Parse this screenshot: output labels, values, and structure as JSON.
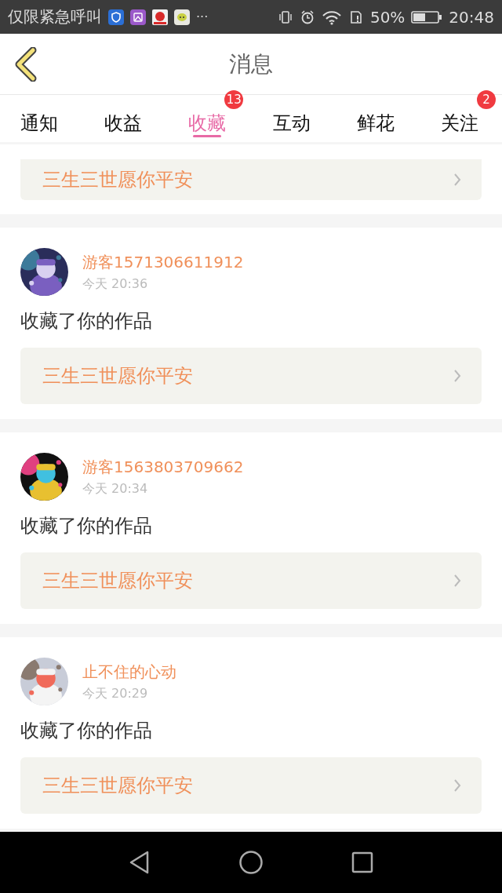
{
  "status_bar": {
    "notice": "仅限紧急呼叫",
    "more": "···",
    "battery": "50%",
    "time": "20:48"
  },
  "header": {
    "title": "消息"
  },
  "tabs": [
    {
      "label": "通知",
      "selected": false
    },
    {
      "label": "收益",
      "selected": false
    },
    {
      "label": "收藏",
      "selected": true,
      "badge": "13"
    },
    {
      "label": "互动",
      "selected": false
    },
    {
      "label": "鲜花",
      "selected": false
    },
    {
      "label": "关注",
      "selected": false,
      "badge": "2"
    }
  ],
  "partial_item": {
    "work_title": "三生三世愿你平安"
  },
  "items": [
    {
      "username": "游客1571306611912",
      "time": "今天 20:36",
      "action": "收藏了你的作品",
      "work_title": "三生三世愿你平安"
    },
    {
      "username": "游客1563803709662",
      "time": "今天 20:34",
      "action": "收藏了你的作品",
      "work_title": "三生三世愿你平安"
    },
    {
      "username": "止不住的心动",
      "time": "今天 20:29",
      "action": "收藏了你的作品",
      "work_title": "三生三世愿你平安"
    }
  ]
}
